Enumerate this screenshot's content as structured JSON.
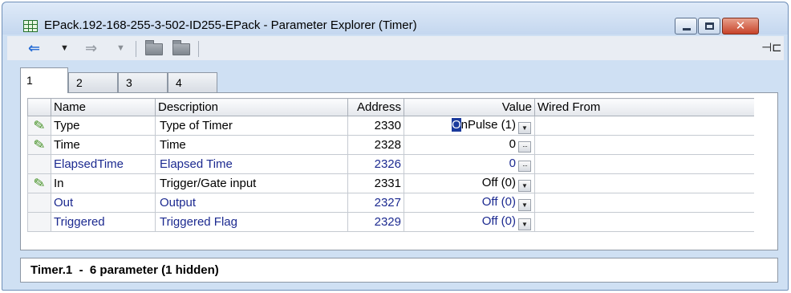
{
  "window": {
    "title": "EPack.192-168-255-3-502-ID255-EPack - Parameter Explorer (Timer)",
    "buttons": {
      "minimize": "minimize-icon",
      "maximize": "maximize-icon",
      "close": "✕"
    }
  },
  "toolbar": {
    "back": "⇐",
    "back_dropdown": "▼",
    "forward": "⇒",
    "forward_dropdown": "▼",
    "pin": "⊣⊏"
  },
  "tabs": [
    {
      "label": "1",
      "active": true
    },
    {
      "label": "2",
      "active": false
    },
    {
      "label": "3",
      "active": false
    },
    {
      "label": "4",
      "active": false
    }
  ],
  "grid": {
    "columns": [
      "Name",
      "Description",
      "Address",
      "Value",
      "Wired From"
    ],
    "rows": [
      {
        "editable": true,
        "name": "Type",
        "description": "Type of Timer",
        "address": "2330",
        "value_caret": "O",
        "value": "nPulse (1)",
        "control": "dropdown"
      },
      {
        "editable": true,
        "name": "Time",
        "description": "Time",
        "address": "2328",
        "value": "0",
        "control": "ellipsis"
      },
      {
        "editable": false,
        "name": "ElapsedTime",
        "description": "Elapsed Time",
        "address": "2326",
        "value": "0",
        "control": "ellipsis"
      },
      {
        "editable": true,
        "name": "In",
        "description": "Trigger/Gate input",
        "address": "2331",
        "value": "Off (0)",
        "control": "dropdown"
      },
      {
        "editable": false,
        "name": "Out",
        "description": "Output",
        "address": "2327",
        "value": "Off (0)",
        "control": "dropdown"
      },
      {
        "editable": false,
        "name": "Triggered",
        "description": "Triggered Flag",
        "address": "2329",
        "value": "Off (0)",
        "control": "dropdown"
      }
    ],
    "editable_icon": "pencil-icon"
  },
  "status": {
    "text": "Timer.1  -  6 parameter (1 hidden)"
  },
  "colors": {
    "readonly_text": "#1c2a90",
    "pencil": "#3f8f1e",
    "back_arrow": "#2a6fd6"
  }
}
